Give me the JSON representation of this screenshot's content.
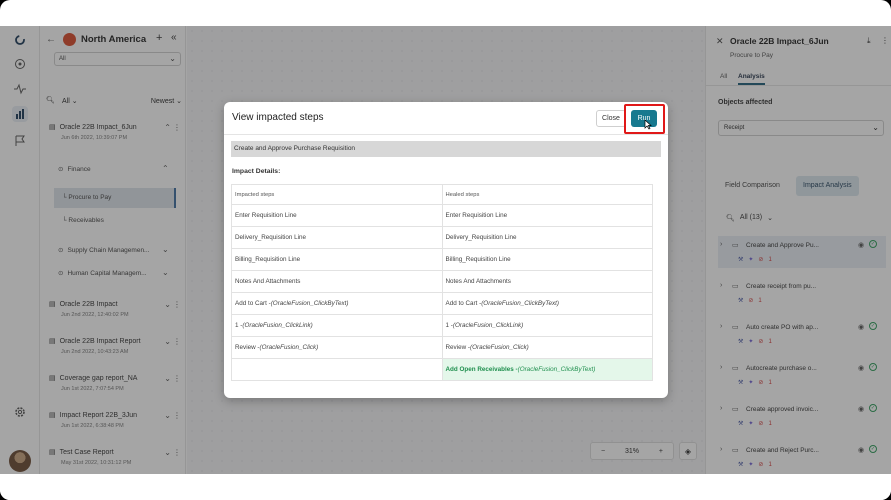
{
  "colors": {
    "primary": "#17798f",
    "highlight": "#e01818",
    "success": "#2e9d5a",
    "added_bg": "#e4f7ea"
  },
  "left_panel": {
    "region": "North America",
    "filter_value": "All",
    "list_filter": "All",
    "sort": "Newest",
    "items": [
      {
        "title": "Oracle 22B Impact_6Jun",
        "date": "Jun 6th 2022, 10:39:07 PM"
      },
      {
        "title": "Oracle 22B Impact",
        "date": "Jun 2nd 2022, 12:40:02 PM"
      },
      {
        "title": "Oracle 22B Impact Report",
        "date": "Jun 2nd 2022, 10:43:23 AM"
      },
      {
        "title": "Coverage gap report_NA",
        "date": "Jun 1st 2022, 7:07:54 PM"
      },
      {
        "title": "Impact Report 22B_3Jun",
        "date": "Jun 1st 2022, 6:38:48 PM"
      },
      {
        "title": "Test Case Report",
        "date": "May 31st 2022, 10:31:12 PM"
      }
    ],
    "groups": [
      "Finance",
      "Supply Chain Managemen...",
      "Human Capital Managem..."
    ],
    "sub_items": [
      "Procure to Pay",
      "Receivables"
    ]
  },
  "canvas": {
    "zoom": "31%",
    "minus": "−",
    "plus": "+"
  },
  "right_panel": {
    "title": "Oracle 22B Impact_6Jun",
    "subtitle": "Procure to Pay",
    "tabs": [
      "All",
      "Analysis"
    ],
    "objects_label": "Objects affected",
    "object_value": "Receipt",
    "subtabs": [
      "Field Comparison",
      "Impact Analysis"
    ],
    "search_filter": "All (13)",
    "rows": [
      {
        "name": "Create and Approve Pu...",
        "count": "1"
      },
      {
        "name": "Create receipt from pu...",
        "count": "1"
      },
      {
        "name": "Auto create PO with ap...",
        "count": "1"
      },
      {
        "name": "Autocreate purchase o...",
        "count": "1"
      },
      {
        "name": "Create approved invoic...",
        "count": "1"
      },
      {
        "name": "Create and Reject Purc...",
        "count": "1"
      }
    ]
  },
  "modal": {
    "title": "View impacted steps",
    "close": "Close",
    "run": "Run",
    "scenario": "Create and Approve Purchase Requisition",
    "details_label": "Impact Details:",
    "headers": [
      "Impacted steps",
      "Healed steps"
    ],
    "rows": [
      {
        "impacted": "Enter Requisition Line",
        "impacted_fn": "",
        "healed": "Enter Requisition Line",
        "healed_fn": ""
      },
      {
        "impacted": "Delivery_Requisition Line",
        "impacted_fn": "",
        "healed": "Delivery_Requisition Line",
        "healed_fn": ""
      },
      {
        "impacted": "Billing_Requisition Line",
        "impacted_fn": "",
        "healed": "Billing_Requisition Line",
        "healed_fn": ""
      },
      {
        "impacted": "Notes And Attachments",
        "impacted_fn": "",
        "healed": "Notes And Attachments",
        "healed_fn": ""
      },
      {
        "impacted": "Add to Cart -",
        "impacted_fn": "(OracleFusion_ClickByText)",
        "healed": "Add to Cart -",
        "healed_fn": "(OracleFusion_ClickByText)"
      },
      {
        "impacted": "1 -",
        "impacted_fn": "(OracleFusion_ClickLink)",
        "healed": "1 -",
        "healed_fn": "(OracleFusion_ClickLink)"
      },
      {
        "impacted": "Review -",
        "impacted_fn": "(OracleFusion_Click)",
        "healed": "Review -",
        "healed_fn": "(OracleFusion_Click)"
      },
      {
        "impacted": "",
        "impacted_fn": "",
        "healed": "Add Open Receivables -",
        "healed_fn": "(OracleFusion_ClickByText)"
      }
    ]
  }
}
